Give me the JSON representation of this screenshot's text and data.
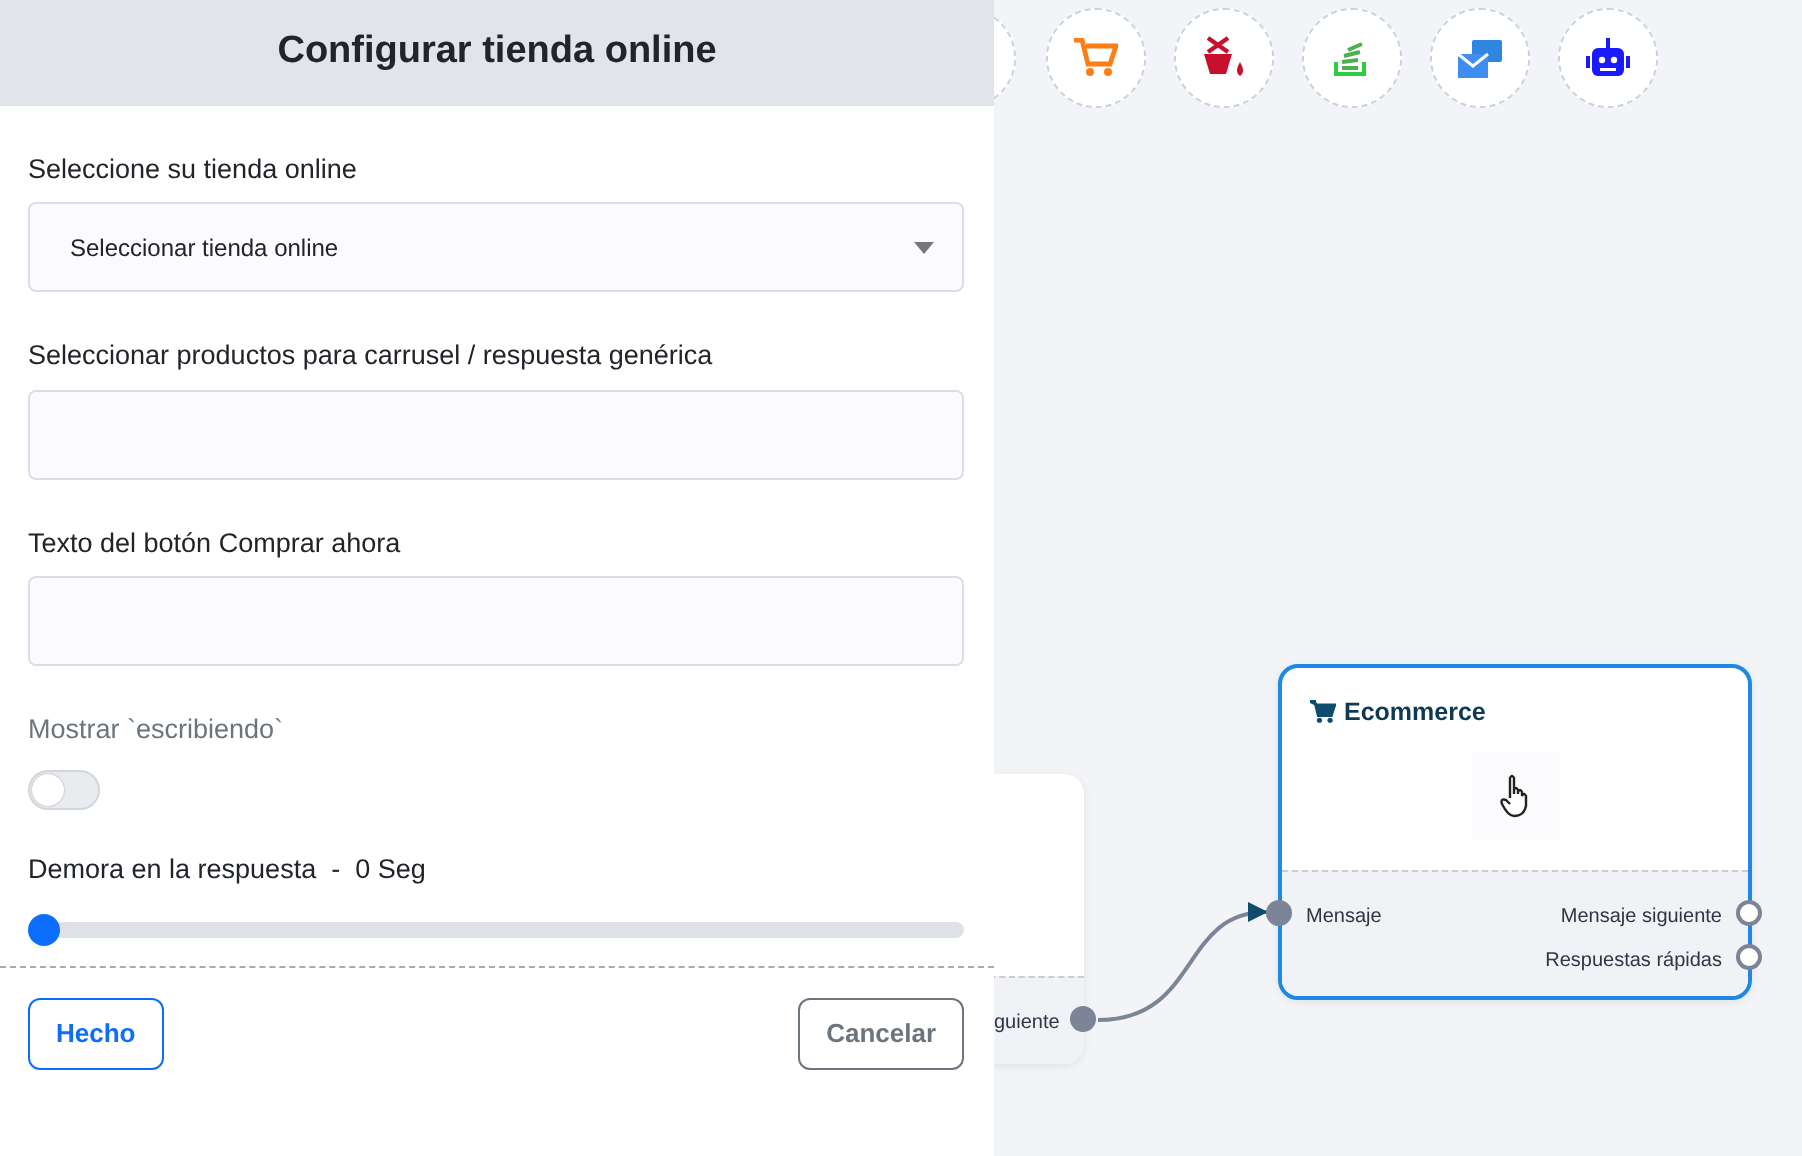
{
  "panel": {
    "title": "Configurar tienda online",
    "fields": [
      {
        "kind": "select",
        "label": "Seleccione su tienda online",
        "value": "Seleccionar tienda online"
      },
      {
        "kind": "text",
        "label": "Seleccionar productos para carrusel / respuesta genérica"
      },
      {
        "kind": "text",
        "label": "Texto del botón Comprar ahora"
      },
      {
        "kind": "toggle",
        "label": "Mostrar `escribiendo`",
        "on": false
      },
      {
        "kind": "slider",
        "label": "Demora en la respuesta",
        "separator": "-",
        "reading": "0 Seg",
        "level": 0
      }
    ],
    "buttons": [
      {
        "kind": "primary",
        "label": "Hecho"
      },
      {
        "kind": "secondary",
        "label": "Cancelar"
      }
    ]
  },
  "canvas": {
    "tools": [
      {
        "kind": "partial"
      },
      {
        "kind": "cart"
      },
      {
        "kind": "bucket"
      },
      {
        "kind": "stack"
      },
      {
        "kind": "mail"
      },
      {
        "kind": "robot"
      }
    ],
    "partial_node": {
      "output": "guiente"
    },
    "node": {
      "title": "Ecommerce",
      "input": "Mensaje",
      "outputs": [
        "Mensaje siguiente",
        "Respuestas rápidas"
      ]
    }
  }
}
